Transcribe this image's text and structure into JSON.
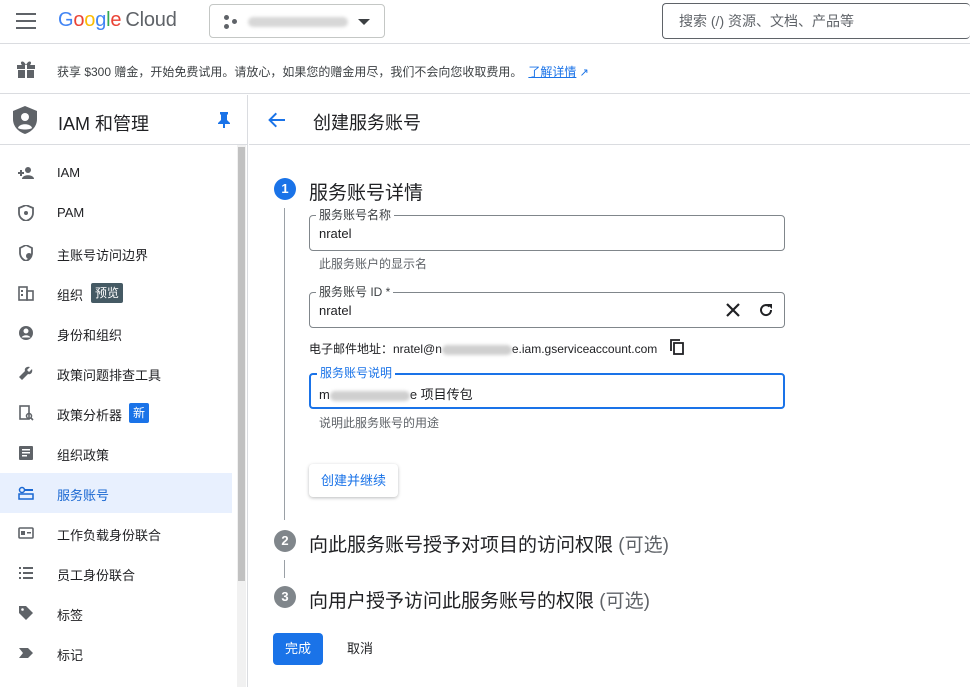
{
  "topbar": {
    "logo": {
      "g1": "G",
      "g2": "o",
      "g3": "o",
      "g4": "g",
      "g5": "l",
      "g6": "e",
      "cloud": "Cloud"
    },
    "project_name": "",
    "search_placeholder": "搜索 (/) 资源、文档、产品等"
  },
  "promo": {
    "text": "获享 $300 赠金，开始免费试用。请放心，如果您的赠金用尽，我们不会向您收取费用。",
    "link": "了解详情"
  },
  "sidebar": {
    "title": "IAM 和管理",
    "items": [
      {
        "label": "IAM"
      },
      {
        "label": "PAM"
      },
      {
        "label": "主账号访问边界"
      },
      {
        "label": "组织",
        "badge": "预览"
      },
      {
        "label": "身份和组织"
      },
      {
        "label": "政策问题排查工具"
      },
      {
        "label": "政策分析器",
        "badge": "新"
      },
      {
        "label": "组织政策"
      },
      {
        "label": "服务账号",
        "active": true
      },
      {
        "label": "工作负载身份联合"
      },
      {
        "label": "员工身份联合"
      },
      {
        "label": "标签"
      },
      {
        "label": "标记"
      }
    ]
  },
  "page": {
    "title": "创建服务账号",
    "steps": [
      {
        "num": "1",
        "title": "服务账号详情"
      },
      {
        "num": "2",
        "title": "向此服务账号授予对项目的访问权限",
        "optional": "(可选)"
      },
      {
        "num": "3",
        "title": "向用户授予访问此服务账号的权限",
        "optional": "(可选)"
      }
    ],
    "fields": {
      "name_label": "服务账号名称",
      "name_value": "nratel",
      "name_hint": "此服务账户的显示名",
      "id_label": "服务账号 ID *",
      "id_value": "nratel",
      "email_prefix": "电子邮件地址：nratel@n",
      "email_suffix": "e.iam.gserviceaccount.com",
      "desc_label": "服务账号说明",
      "desc_value_prefix": "m",
      "desc_value_suffix": "e 项目传包",
      "desc_hint": "说明此服务账号的用途"
    },
    "create_continue": "创建并继续",
    "done": "完成",
    "cancel": "取消"
  },
  "colors": {
    "accent": "#1a73e8",
    "active_bg": "#e8f0fe"
  }
}
